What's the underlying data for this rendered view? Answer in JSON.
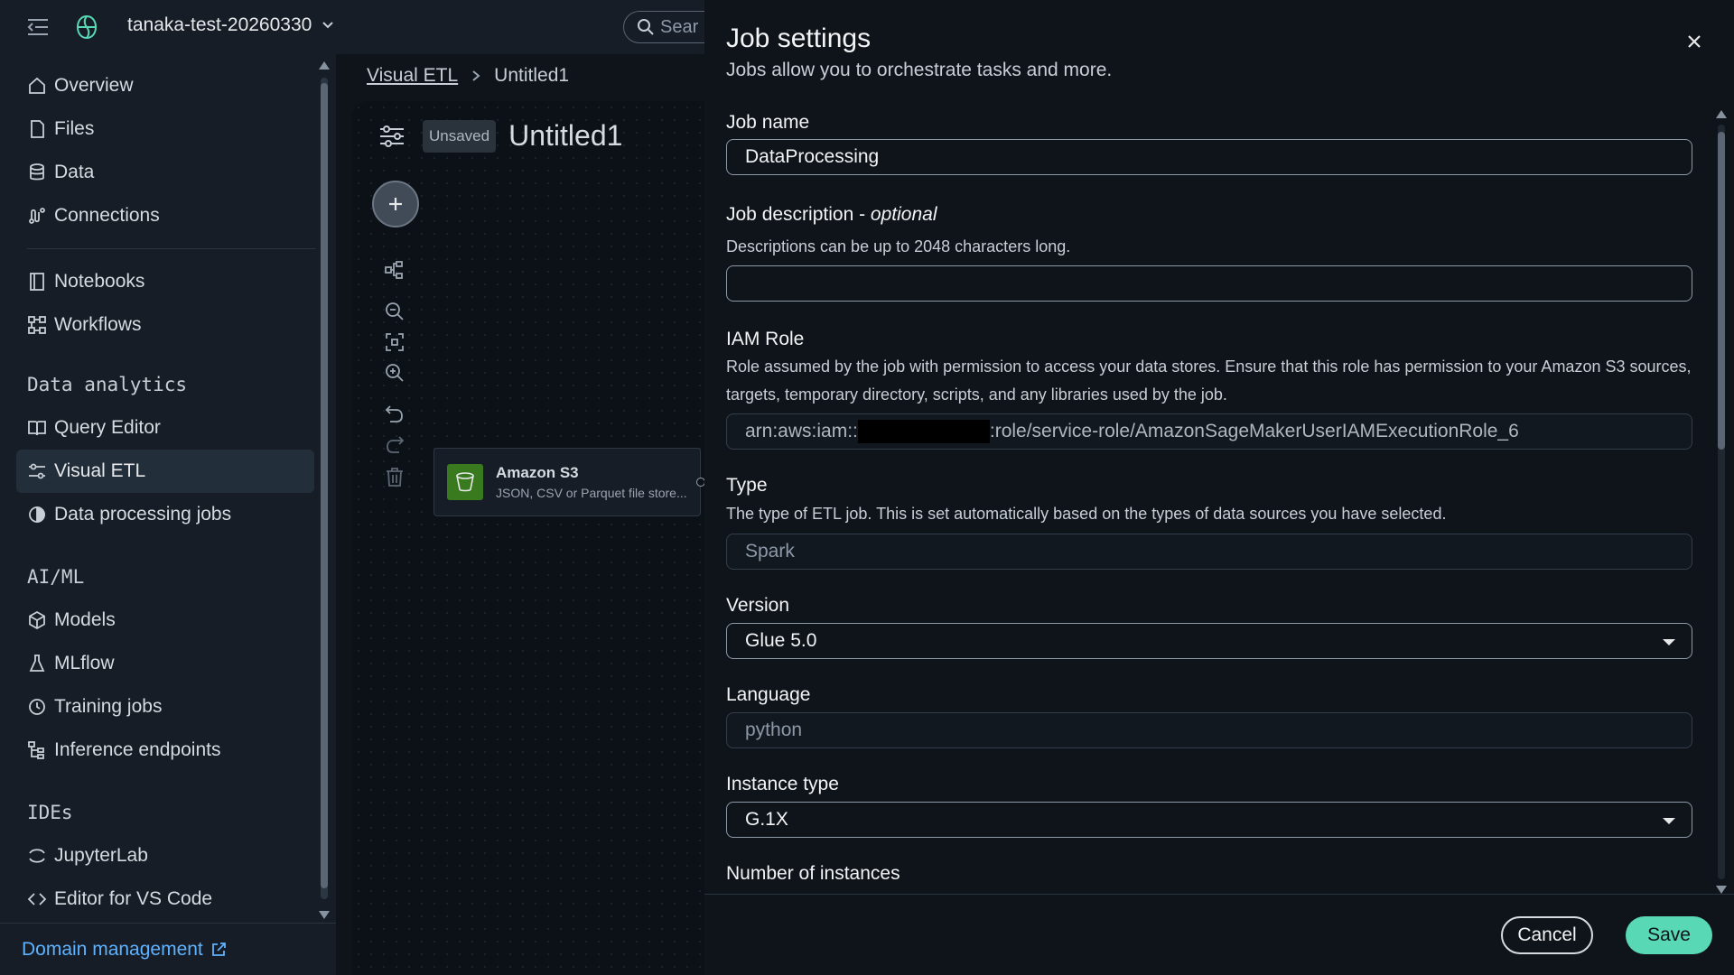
{
  "topbar": {
    "project_name": "tanaka-test-20260330",
    "search_placeholder": "Sear"
  },
  "sidebar": {
    "items": [
      {
        "label": "Overview"
      },
      {
        "label": "Files"
      },
      {
        "label": "Data"
      },
      {
        "label": "Connections"
      },
      {
        "label": "Notebooks"
      },
      {
        "label": "Workflows"
      },
      {
        "label": "Query Editor"
      },
      {
        "label": "Visual ETL"
      },
      {
        "label": "Data processing jobs"
      },
      {
        "label": "Models"
      },
      {
        "label": "MLflow"
      },
      {
        "label": "Training jobs"
      },
      {
        "label": "Inference endpoints"
      },
      {
        "label": "JupyterLab"
      },
      {
        "label": "Editor for VS Code"
      }
    ],
    "sections": {
      "data_analytics": "Data analytics",
      "ai_ml": "AI/ML",
      "ides": "IDEs"
    },
    "active_item": "Visual ETL",
    "footer_link": "Domain management"
  },
  "breadcrumb": {
    "parent": "Visual ETL",
    "current": "Untitled1"
  },
  "canvas": {
    "badge": "Unsaved",
    "title": "Untitled1",
    "node": {
      "title": "Amazon S3",
      "subtitle": "JSON, CSV or Parquet file store..."
    }
  },
  "panel": {
    "title": "Job settings",
    "subtitle": "Jobs allow you to orchestrate tasks and more.",
    "job_name": {
      "label": "Job name",
      "value": "DataProcessing"
    },
    "job_description": {
      "label": "Job description - ",
      "label_optional": "optional",
      "help": "Descriptions can be up to 2048 characters long.",
      "value": ""
    },
    "iam_role": {
      "label": "IAM Role",
      "help": "Role assumed by the job with permission to access your data stores. Ensure that this role has permission to your Amazon S3 sources, targets, temporary directory, scripts, and any libraries used by the job.",
      "value_prefix": "arn:aws:iam::",
      "value_suffix": ":role/service-role/AmazonSageMakerUserIAMExecutionRole_6"
    },
    "type": {
      "label": "Type",
      "help": "The type of ETL job. This is set automatically based on the types of data sources you have selected.",
      "value": "Spark"
    },
    "version": {
      "label": "Version",
      "value": "Glue 5.0"
    },
    "language": {
      "label": "Language",
      "value": "python"
    },
    "instance_type": {
      "label": "Instance type",
      "value": "G.1X"
    },
    "number_of_instances": {
      "label": "Number of instances"
    },
    "cancel_label": "Cancel",
    "save_label": "Save"
  },
  "colors": {
    "accent_save": "#58d8b4",
    "link": "#5fb2ff",
    "active_nav": "#232e3b"
  }
}
